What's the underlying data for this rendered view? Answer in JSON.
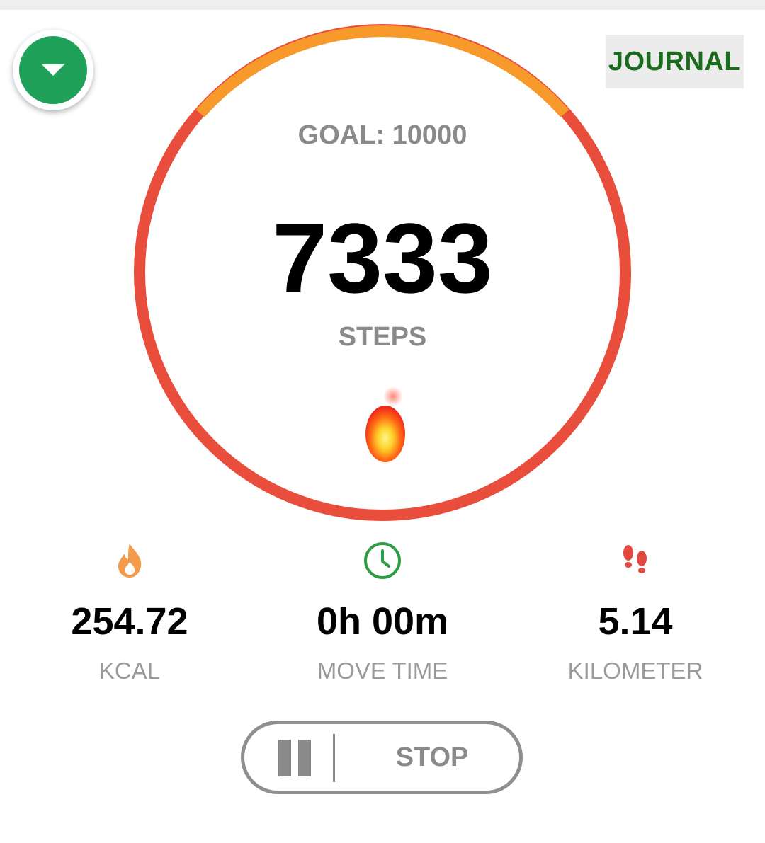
{
  "header": {
    "journal_label": "JOURNAL",
    "dropdown_icon": "chevron-down-icon"
  },
  "progress": {
    "goal_text": "GOAL: 10000",
    "steps_value": "7333",
    "steps_label": "STEPS",
    "ring_colors": {
      "primary": "#e94e3c",
      "secondary": "#f79a2b"
    }
  },
  "stats": {
    "kcal": {
      "value": "254.72",
      "label": "KCAL",
      "icon": "flame-icon",
      "color": "#f39a4b"
    },
    "move_time": {
      "value": "0h 00m",
      "label": "MOVE TIME",
      "icon": "clock-icon",
      "color": "#2f9c46"
    },
    "distance": {
      "value": "5.14",
      "label": "KILOMETER",
      "icon": "footprints-icon",
      "color": "#e24a40"
    }
  },
  "controls": {
    "pause_icon": "pause-icon",
    "stop_label": "STOP"
  },
  "colors": {
    "accent_green": "#1fa15a",
    "journal_text": "#1b6b1e"
  }
}
